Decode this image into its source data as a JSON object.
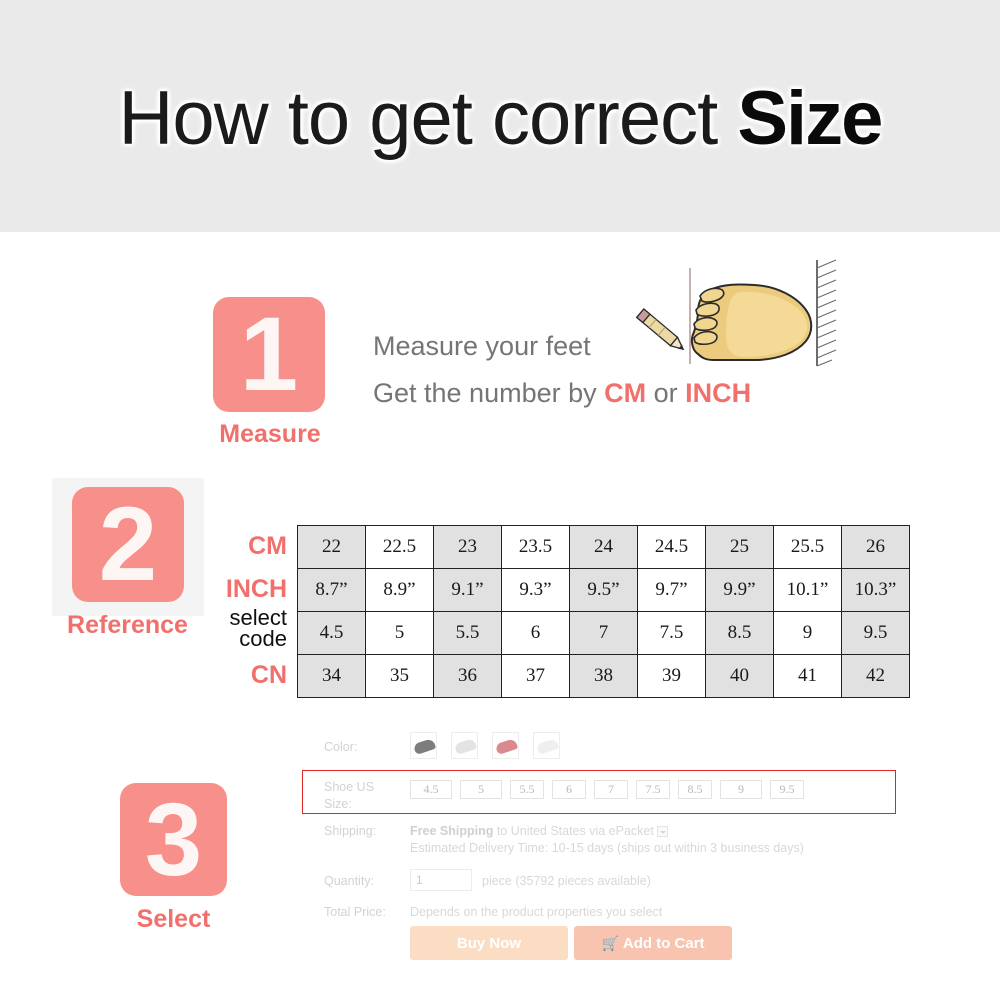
{
  "header": {
    "title_light": "How to get correct ",
    "title_bold": "Size"
  },
  "steps": [
    {
      "number": "1",
      "caption": "Measure"
    },
    {
      "number": "2",
      "caption": "Reference"
    },
    {
      "number": "3",
      "caption": "Select"
    }
  ],
  "step1": {
    "line1": "Measure your feet",
    "line2_prefix": "Get the number by ",
    "line2_unit1": "CM",
    "line2_mid": " or ",
    "line2_unit2": "INCH"
  },
  "table": {
    "row_labels": {
      "cm": "CM",
      "inch": "INCH",
      "code_line1": "select",
      "code_line2": "code",
      "cn": "CN"
    },
    "rows": {
      "cm": [
        "22",
        "22.5",
        "23",
        "23.5",
        "24",
        "24.5",
        "25",
        "25.5",
        "26"
      ],
      "inch": [
        "8.7”",
        "8.9”",
        "9.1”",
        "9.3”",
        "9.5”",
        "9.7”",
        "9.9”",
        "10.1”",
        "10.3”"
      ],
      "code": [
        "4.5",
        "5",
        "5.5",
        "6",
        "7",
        "7.5",
        "8.5",
        "9",
        "9.5"
      ],
      "cn": [
        "34",
        "35",
        "36",
        "37",
        "38",
        "39",
        "40",
        "41",
        "42"
      ]
    }
  },
  "product": {
    "color_label": "Color:",
    "color_swatches": [
      "gray-shoe-thumb",
      "white-shoe-thumb",
      "red-shoe-thumb",
      "light-shoe-thumb"
    ],
    "size_label_line1": "Shoe US",
    "size_label_line2": "Size:",
    "size_options": [
      "4.5",
      "5",
      "5.5",
      "6",
      "7",
      "7.5",
      "8.5",
      "9",
      "9.5"
    ],
    "shipping_label": "Shipping:",
    "shipping_bold": "Free Shipping",
    "shipping_rest": " to United States via ePacket",
    "shipping_note": "Estimated Delivery Time: 10-15 days (ships out within 3 business days)",
    "quantity_label": "Quantity:",
    "quantity_value": "1",
    "quantity_suffix": "piece (35792 pieces available)",
    "total_price_label": "Total Price:",
    "total_price_value": "Depends on the product properties you select",
    "buy_now_label": "Buy Now",
    "add_to_cart_label": "Add to Cart",
    "cart_icon": "shopping-cart-icon"
  },
  "colors": {
    "accent": "#f2706c",
    "step_block": "#f78f8b",
    "header_band": "#eaeaea",
    "table_shade": "#e1e1e1",
    "highlight_border": "#e02424",
    "buy_now_bg": "#fbddc4",
    "add_cart_bg": "#f8c4b0"
  }
}
